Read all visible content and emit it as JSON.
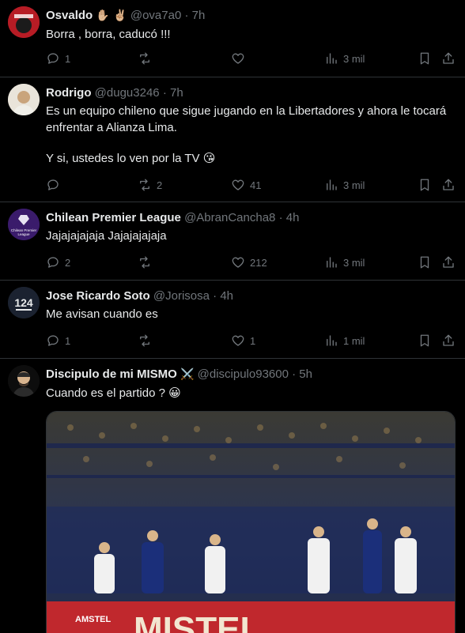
{
  "tweets": [
    {
      "name": "Osvaldo",
      "name_emoji": "✋🏼 ✌🏼",
      "handle": "@ova7a0",
      "time": "7h",
      "text": [
        "Borra , borra, caducó !!!"
      ],
      "replies": "1",
      "retweets": "",
      "likes": "",
      "views": "3 mil"
    },
    {
      "name": "Rodrigo",
      "name_emoji": "",
      "handle": "@dugu3246",
      "time": "7h",
      "text": [
        "Es un equipo chileno que sigue jugando en la Libertadores y ahora le tocará",
        "enfrentar a Alianza Lima.",
        "",
        "Y si, ustedes lo ven por la TV 😘"
      ],
      "replies": "",
      "retweets": "2",
      "likes": "41",
      "views": "3 mil"
    },
    {
      "name": "Chilean Premier League",
      "name_emoji": "",
      "handle": "@AbranCancha8",
      "time": "4h",
      "avatar_text": "Chilean Premier League",
      "text": [
        "Jajajajajaja Jajajajajaja"
      ],
      "replies": "2",
      "retweets": "",
      "likes": "212",
      "views": "3 mil"
    },
    {
      "name": "Jose Ricardo Soto",
      "name_emoji": "",
      "handle": "@Jorisosa",
      "time": "4h",
      "avatar_text": "124",
      "text": [
        "Me avisan cuando es"
      ],
      "replies": "1",
      "retweets": "",
      "likes": "1",
      "views": "1 mil"
    },
    {
      "name": "Discipulo de mi MISMO",
      "name_emoji": "⚔️",
      "handle": "@discipulo93600",
      "time": "5h",
      "text": [
        "Cuando es el partido ? 😀"
      ],
      "media": {
        "banner": "AMSTEL",
        "banner_text": "MISTEL"
      }
    }
  ],
  "colors": {
    "background": "#000000",
    "text": "#e7e9ea",
    "muted": "#71767b",
    "border": "#2f3336"
  },
  "icons": [
    "reply-icon",
    "retweet-icon",
    "like-icon",
    "views-icon",
    "bookmark-icon",
    "share-icon"
  ]
}
